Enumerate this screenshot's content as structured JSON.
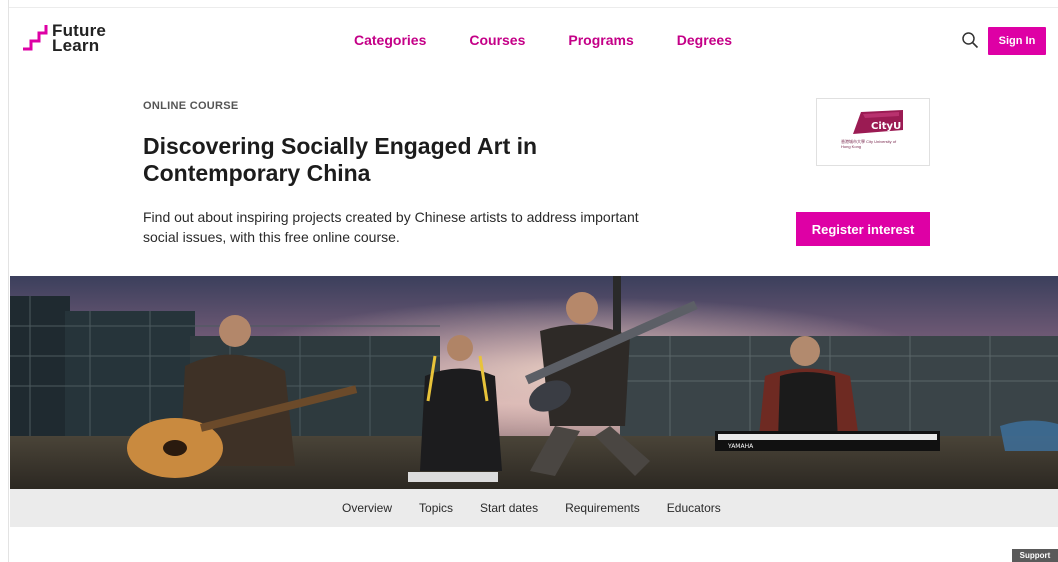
{
  "header": {
    "logo_line1": "Future",
    "logo_line2": "Learn",
    "nav": [
      {
        "label": "Categories"
      },
      {
        "label": "Courses"
      },
      {
        "label": "Programs"
      },
      {
        "label": "Degrees"
      }
    ],
    "sign_in_label": "Sign In"
  },
  "course": {
    "eyebrow": "ONLINE COURSE",
    "title": "Discovering Socially Engaged Art in Contemporary China",
    "description": "Find out about inspiring projects created by Chinese artists to address important social issues, with this free online course.",
    "register_label": "Register interest",
    "partner": {
      "name": "CityU",
      "caption": "香港城市大學 City University of Hong Kong"
    }
  },
  "banner": {
    "keyboard_brand": "YAMAHA"
  },
  "subnav": [
    {
      "label": "Overview"
    },
    {
      "label": "Topics"
    },
    {
      "label": "Start dates"
    },
    {
      "label": "Requirements"
    },
    {
      "label": "Educators"
    }
  ],
  "support_label": "Support",
  "colors": {
    "brand_pink": "#de00a5",
    "nav_pink": "#c40087",
    "subnav_bg": "#ebebeb"
  },
  "icons": {
    "logo": "futurelearn-stair-icon",
    "search": "search-icon"
  }
}
